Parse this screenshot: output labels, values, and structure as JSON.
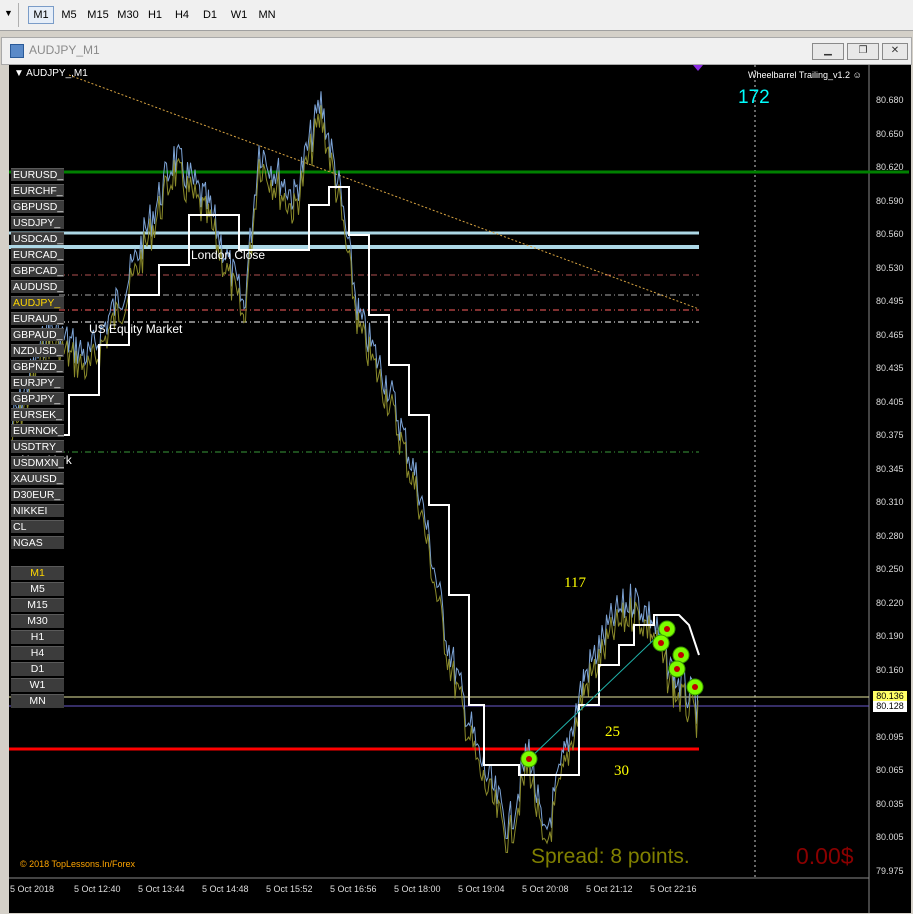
{
  "toolbar": {
    "timeframes": [
      "M1",
      "M5",
      "M15",
      "M30",
      "H1",
      "H4",
      "D1",
      "W1",
      "MN"
    ],
    "active": "M1"
  },
  "window": {
    "title": "AUDJPY_M1"
  },
  "chart": {
    "symbol_label": "AUDJPY_,M1",
    "indicator": "Wheelbarrel Trailing_v1.2",
    "indicator_icon": "smiley-icon",
    "counter": "172",
    "label_117": "117",
    "label_25": "25",
    "label_30": "30",
    "session_london": "London Close",
    "session_us": "US Equity Market",
    "session_ny": "New York",
    "spread": "Spread: 8 points.",
    "profit": "0.00$",
    "copyright": "© 2018 TopLessons.In/Forex",
    "bid_tag": "80.136",
    "ask_tag": "80.128",
    "colors": {
      "background": "#000000",
      "trail": "#ffffff",
      "green_line": "#008000",
      "red_line": "#ff0000",
      "light_blue": "#add8e6",
      "spread_text": "#808000",
      "profit_text": "#8b0000",
      "counter_text": "#00ffff",
      "number_text": "#ffff00"
    }
  },
  "symbols": [
    "EURUSD_",
    "EURCHF_",
    "GBPUSD_",
    "USDJPY_",
    "USDCAD_",
    "EURCAD_",
    "GBPCAD_",
    "AUDUSD_",
    "AUDJPY_",
    "EURAUD_",
    "GBPAUD_",
    "NZDUSD_",
    "GBPNZD_",
    "EURJPY_",
    "GBPJPY_",
    "EURSEK_",
    "EURNOK_",
    "USDTRY_",
    "USDMXN_",
    "XAUUSD_",
    "D30EUR_",
    "NIKKEI",
    "CL",
    "NGAS"
  ],
  "current_symbol": "AUDJPY_",
  "tf_panel": [
    "M1",
    "M5",
    "M15",
    "M30",
    "H1",
    "H4",
    "D1",
    "W1",
    "MN"
  ],
  "price_axis": [
    "80.680",
    "80.650",
    "80.620",
    "80.590",
    "80.560",
    "80.530",
    "80.495",
    "80.465",
    "80.435",
    "80.405",
    "80.375",
    "80.345",
    "80.310",
    "80.280",
    "80.250",
    "80.220",
    "80.190",
    "80.160",
    "80.125",
    "80.095",
    "80.065",
    "80.035",
    "80.005",
    "79.975"
  ],
  "time_axis": [
    "5 Oct 2018",
    "5 Oct 12:40",
    "5 Oct 13:44",
    "5 Oct 14:48",
    "5 Oct 15:52",
    "5 Oct 16:56",
    "5 Oct 18:00",
    "5 Oct 19:04",
    "5 Oct 20:08",
    "5 Oct 21:12",
    "5 Oct 22:16"
  ],
  "chart_data": {
    "type": "line",
    "series": [
      {
        "x": [
          "12:00",
          "12:20",
          "12:40",
          "13:00",
          "13:20",
          "13:40",
          "14:00",
          "14:20",
          "14:40",
          "15:00",
          "15:20",
          "15:40",
          "16:00",
          "16:20",
          "16:40",
          "17:00",
          "17:20",
          "17:40",
          "18:00",
          "18:20",
          "18:40",
          "19:00",
          "19:20",
          "19:40",
          "20:00",
          "20:20",
          "20:40",
          "21:00",
          "21:20",
          "21:40",
          "22:00",
          "22:20",
          "22:30"
        ],
        "values": [
          80.4,
          80.45,
          80.46,
          80.49,
          80.55,
          80.61,
          80.58,
          80.55,
          80.52,
          80.6,
          80.56,
          80.62,
          80.52,
          80.45,
          80.4,
          80.33,
          80.25,
          80.18,
          80.1,
          80.05,
          80.02,
          80.06,
          80.02,
          80.06,
          80.12,
          80.16,
          80.19,
          80.2,
          80.22,
          80.25,
          80.19,
          80.14,
          80.12
        ]
      }
    ],
    "ylim": [
      79.975,
      80.695
    ]
  }
}
